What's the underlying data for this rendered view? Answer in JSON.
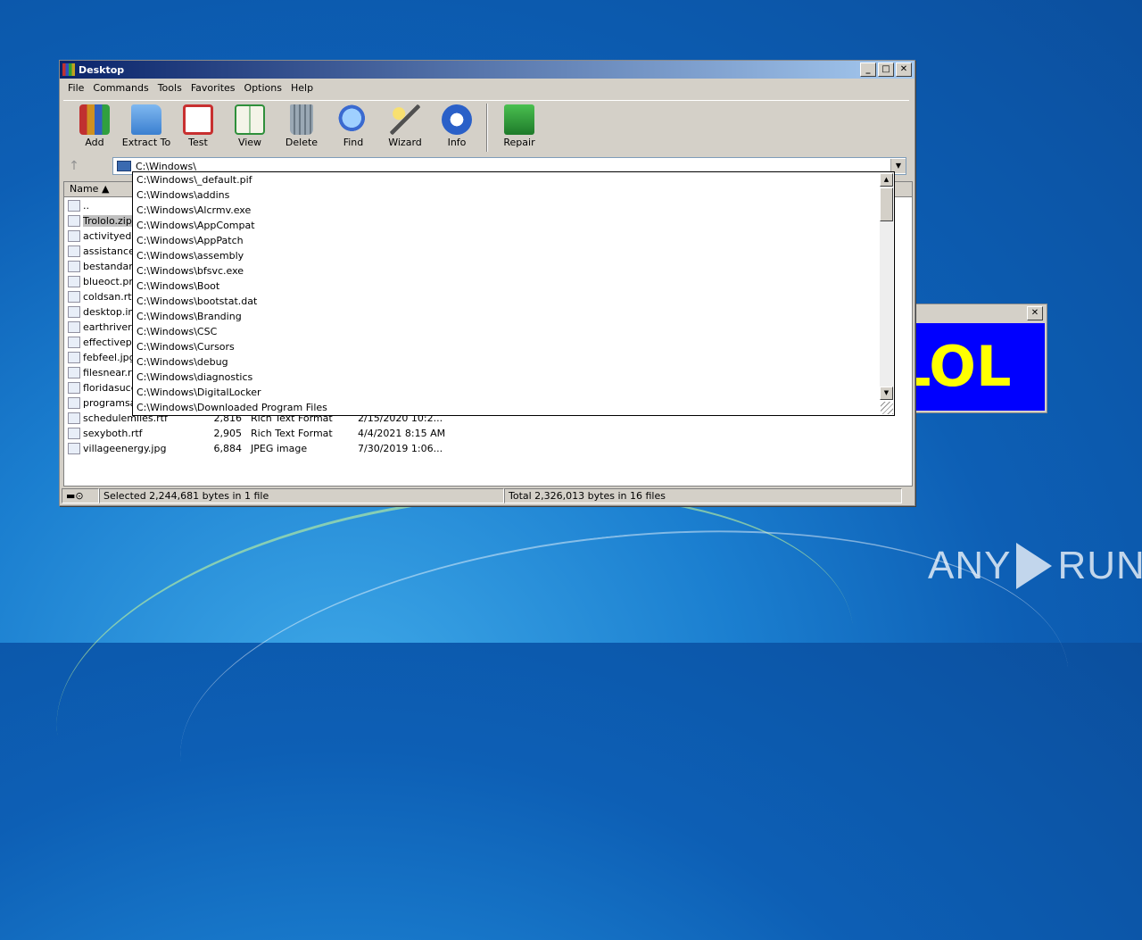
{
  "window": {
    "title": "Desktop",
    "controls": {
      "minimize": "_",
      "maximize": "□",
      "close": "✕"
    }
  },
  "menu": [
    "File",
    "Commands",
    "Tools",
    "Favorites",
    "Options",
    "Help"
  ],
  "toolbar": [
    {
      "label": "Add",
      "icon": "add-archive-icon",
      "color": "#b8862a"
    },
    {
      "label": "Extract To",
      "icon": "extract-folder-icon",
      "color": "#4a8fd8"
    },
    {
      "label": "Test",
      "icon": "test-clipboard-icon",
      "color": "#c83030"
    },
    {
      "label": "View",
      "icon": "view-book-icon",
      "color": "#2e8f3a"
    },
    {
      "label": "Delete",
      "icon": "delete-trash-icon",
      "color": "#8a9aa8"
    },
    {
      "label": "Find",
      "icon": "find-magnifier-icon",
      "color": "#3a6ad0"
    },
    {
      "label": "Wizard",
      "icon": "wizard-wand-icon",
      "color": "#e8d060"
    },
    {
      "label": "Info",
      "icon": "info-icon",
      "color": "#2a60c8"
    },
    {
      "label": "Repair",
      "icon": "repair-icon",
      "color": "#2a9a3a"
    }
  ],
  "address": {
    "value": "C:\\Windows\\"
  },
  "columns": {
    "name": "Name"
  },
  "files": [
    {
      "name": "..",
      "size": "",
      "type": "",
      "date": ""
    },
    {
      "name": "Trololo.zip",
      "size": "",
      "type": "",
      "date": "",
      "selected": true
    },
    {
      "name": "activityedit",
      "size": "",
      "type": "",
      "date": ""
    },
    {
      "name": "assistanceb",
      "size": "",
      "type": "",
      "date": ""
    },
    {
      "name": "bestandard",
      "size": "",
      "type": "",
      "date": ""
    },
    {
      "name": "blueoct.png",
      "size": "",
      "type": "",
      "date": ""
    },
    {
      "name": "coldsan.rtf",
      "size": "",
      "type": "",
      "date": ""
    },
    {
      "name": "desktop.ini",
      "size": "",
      "type": "",
      "date": ""
    },
    {
      "name": "earthriver.",
      "size": "",
      "type": "",
      "date": ""
    },
    {
      "name": "effectivepa",
      "size": "",
      "type": "",
      "date": ""
    },
    {
      "name": "febfeel.jpg",
      "size": "",
      "type": "",
      "date": ""
    },
    {
      "name": "filesnear.rt",
      "size": "",
      "type": "",
      "date": ""
    },
    {
      "name": "floridasucce",
      "size": "",
      "type": "",
      "date": ""
    },
    {
      "name": "programsat",
      "size": "",
      "type": "",
      "date": ""
    },
    {
      "name": "schedulemiles.rtf",
      "size": "2,816",
      "type": "Rich Text Format",
      "date": "2/15/2020 10:2..."
    },
    {
      "name": "sexyboth.rtf",
      "size": "2,905",
      "type": "Rich Text Format",
      "date": "4/4/2021 8:15 AM"
    },
    {
      "name": "villageenergy.jpg",
      "size": "6,884",
      "type": "JPEG image",
      "date": "7/30/2019 1:06..."
    }
  ],
  "dropdown_items": [
    "C:\\Windows\\_default.pif",
    "C:\\Windows\\addins",
    "C:\\Windows\\Alcrmv.exe",
    "C:\\Windows\\AppCompat",
    "C:\\Windows\\AppPatch",
    "C:\\Windows\\assembly",
    "C:\\Windows\\bfsvc.exe",
    "C:\\Windows\\Boot",
    "C:\\Windows\\bootstat.dat",
    "C:\\Windows\\Branding",
    "C:\\Windows\\CSC",
    "C:\\Windows\\Cursors",
    "C:\\Windows\\debug",
    "C:\\Windows\\diagnostics",
    "C:\\Windows\\DigitalLocker",
    "C:\\Windows\\Downloaded Program Files"
  ],
  "status": {
    "selected": "Selected 2,244,681 bytes in 1 file",
    "total": "Total 2,326,013 bytes in 16 files"
  },
  "popup": {
    "text": "LOL",
    "close": "✕"
  },
  "watermark": {
    "left": "ANY",
    "right": "RUN"
  }
}
